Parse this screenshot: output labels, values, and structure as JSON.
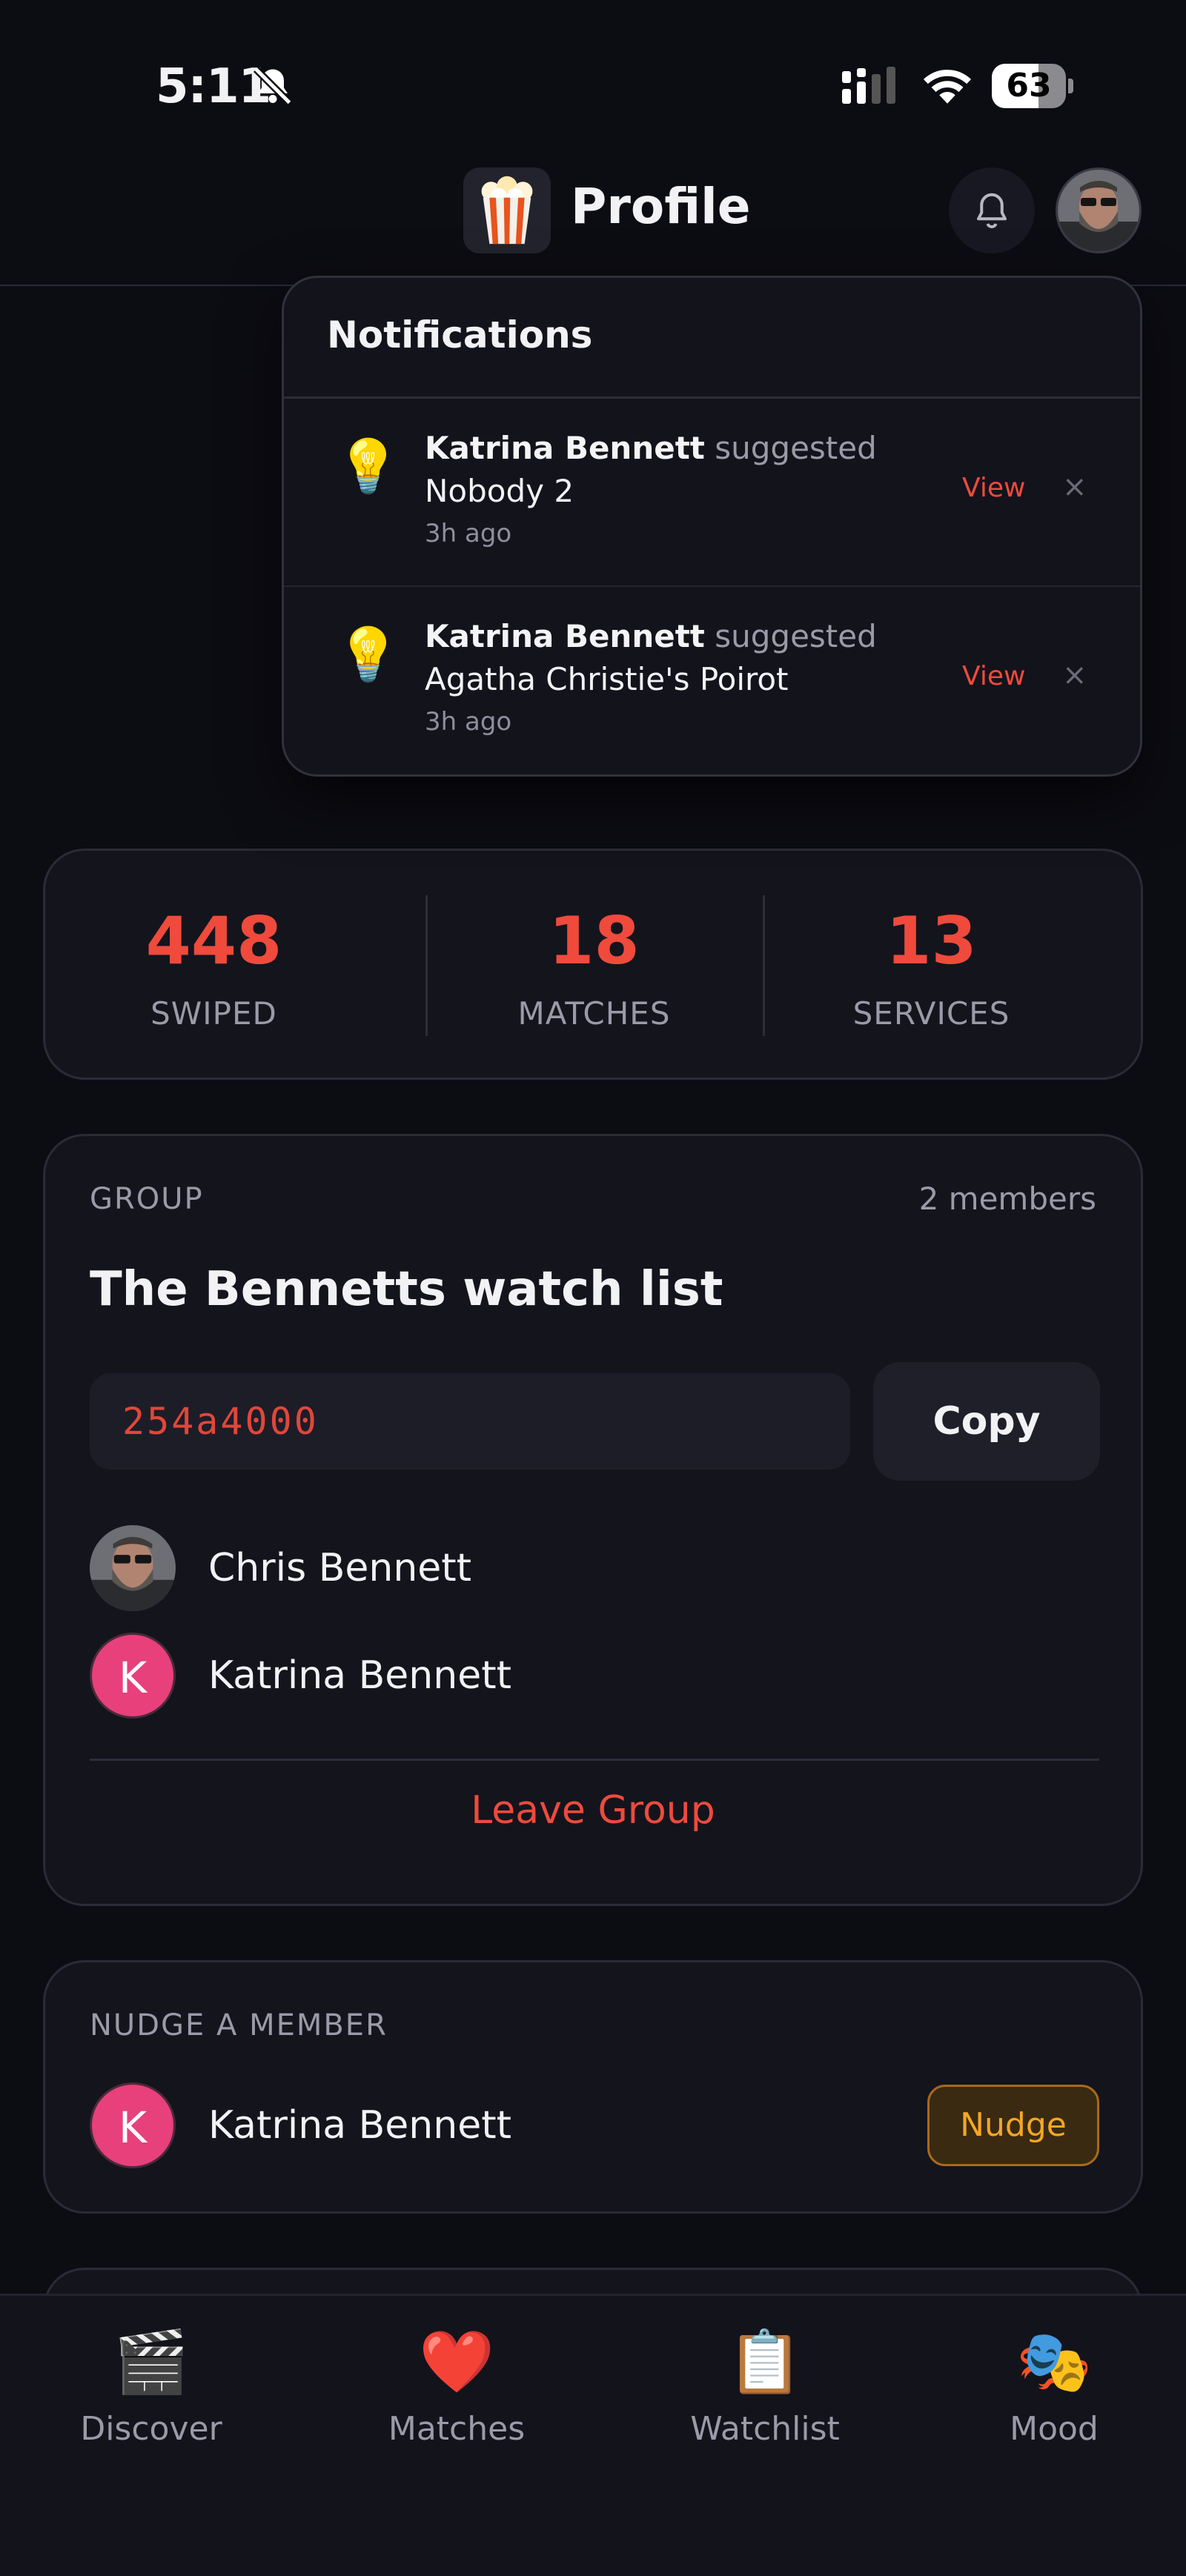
{
  "status_bar": {
    "time": "5:11",
    "battery_percent": 63,
    "battery_label": "63",
    "icons": [
      "bell-slash-icon",
      "cellular-signal-icon",
      "wifi-icon",
      "battery-icon"
    ]
  },
  "header": {
    "title": "Profile",
    "logo_icon": "popcorn-icon",
    "bell_icon": "bell-icon",
    "avatar_icon": "user-avatar"
  },
  "notifications": {
    "title": "Notifications",
    "items": [
      {
        "who": "Katrina Bennett",
        "verb": "suggested",
        "show": "Nobody 2",
        "time": "3h ago",
        "view_label": "View",
        "close": "×",
        "icon": "lightbulb-icon"
      },
      {
        "who": "Katrina Bennett",
        "verb": "suggested",
        "show": "Agatha Christie's Poirot",
        "time": "3h ago",
        "view_label": "View",
        "close": "×",
        "icon": "lightbulb-icon"
      }
    ]
  },
  "stats": [
    {
      "value": "448",
      "label": "SWIPED"
    },
    {
      "value": "18",
      "label": "MATCHES"
    },
    {
      "value": "13",
      "label": "SERVICES"
    }
  ],
  "group": {
    "section_label": "GROUP",
    "members_count": "2 members",
    "name": "The Bennetts watch list",
    "code": "254a4000",
    "copy_label": "Copy",
    "members": [
      {
        "name": "Chris Bennett",
        "avatar": "photo"
      },
      {
        "name": "Katrina Bennett",
        "initial": "K"
      }
    ],
    "leave_label": "Leave Group"
  },
  "nudge": {
    "section_label": "NUDGE A MEMBER",
    "member": {
      "name": "Katrina Bennett",
      "initial": "K"
    },
    "button_label": "Nudge"
  },
  "bottom_nav": [
    {
      "label": "Discover",
      "icon": "🎬",
      "icon_name": "clapper-board-icon"
    },
    {
      "label": "Matches",
      "icon": "❤️",
      "icon_name": "heart-icon"
    },
    {
      "label": "Watchlist",
      "icon": "📋",
      "icon_name": "clipboard-icon"
    },
    {
      "label": "Mood",
      "icon": "🎭",
      "icon_name": "theater-masks-icon"
    }
  ],
  "colors": {
    "background": "#0c0c13",
    "card": "#14141d",
    "accent_red": "#ef4a3c",
    "avatar_pink": "#e8407b",
    "nudge_orange": "#f5a623",
    "muted_text": "#9a9aa8"
  }
}
